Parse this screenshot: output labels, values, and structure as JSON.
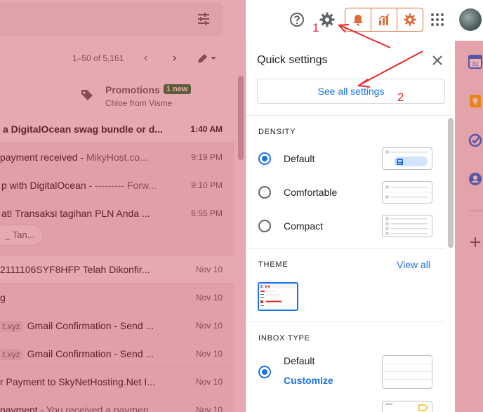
{
  "mailbox": {
    "range_text": "1–50 of 5,161",
    "promotions": {
      "title": "Promotions",
      "badge": "1 new",
      "sender": "Chloe from Visme"
    },
    "rows": [
      {
        "subject": "a DigitalOcean swag bundle or d...",
        "time": "1:40 AM",
        "unread": true
      },
      {
        "subject": "payment received - ",
        "snippet": "MikyHost.co...",
        "time": "9:19 PM"
      },
      {
        "subject": "p with DigitalOcean - ",
        "snippet": "--------- Forw...",
        "time": "9:10 PM"
      },
      {
        "subject": "at! Transaksi tagihan PLN Anda ...",
        "time": "6:55 PM",
        "attachment": "_ Tan..."
      },
      {
        "subject": "2111106SYF8HFP Telah Dikonfir...",
        "time": "Nov 10"
      },
      {
        "subject": "g",
        "time": "Nov 10"
      },
      {
        "chip": "t.xyz",
        "subject": "Gmail Confirmation - Send ...",
        "time": "Nov 10"
      },
      {
        "chip": "t.xyz",
        "subject": "Gmail Confirmation - Send ...",
        "time": "Nov 10"
      },
      {
        "subject": "r Payment to SkyNetHosting.Net I...",
        "time": "Nov 10"
      },
      {
        "subject": "payment - ",
        "snippet": "You received a paymen...",
        "time": "Nov 10"
      }
    ]
  },
  "quick_settings": {
    "title": "Quick settings",
    "see_all_label": "See all settings",
    "density": {
      "heading": "DENSITY",
      "options": [
        {
          "label": "Default",
          "selected": true
        },
        {
          "label": "Comfortable",
          "selected": false
        },
        {
          "label": "Compact",
          "selected": false
        }
      ]
    },
    "theme": {
      "heading": "THEME",
      "view_all_label": "View all",
      "thumb_text": "Gmail"
    },
    "inbox_type": {
      "heading": "INBOX TYPE",
      "option_label": "Default",
      "customize_label": "Customize"
    }
  },
  "annotations": {
    "step1": "1",
    "step2": "2"
  },
  "icons": {
    "topbar": [
      "help-icon",
      "settings-gear-icon",
      "bell-icon",
      "analytics-icon",
      "orange-gear-icon",
      "apps-grid-icon"
    ],
    "side": [
      "calendar-icon",
      "keep-icon",
      "tasks-icon",
      "contacts-icon",
      "add-icon"
    ]
  },
  "colors": {
    "annotation_red": "#e8262b",
    "link_blue": "#1a73e8",
    "ext_orange": "#dc6d3a"
  }
}
